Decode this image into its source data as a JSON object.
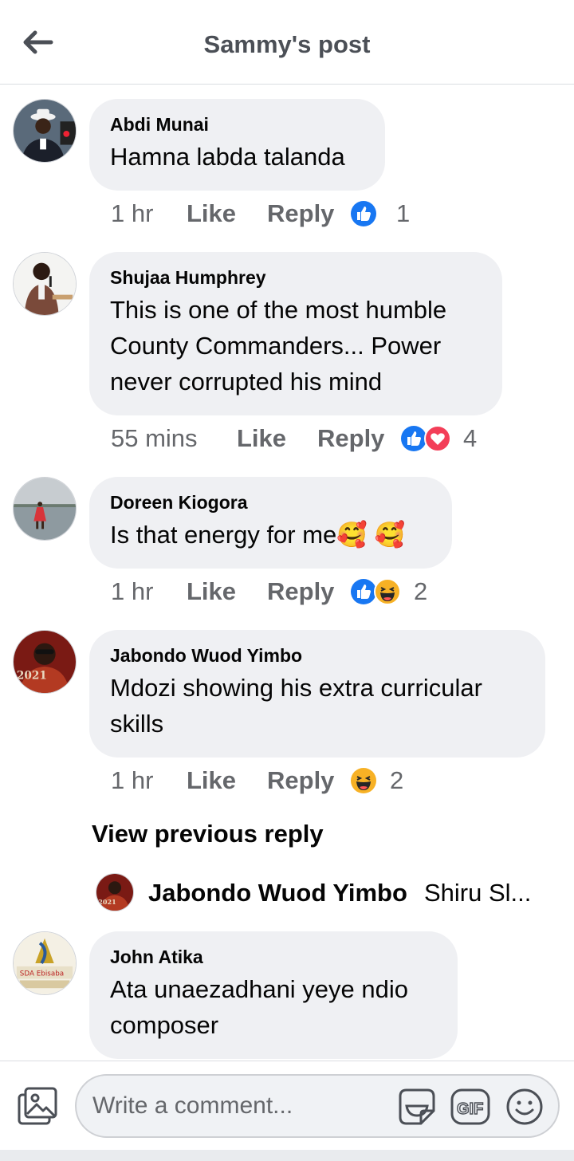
{
  "header": {
    "title": "Sammy's post"
  },
  "comments": [
    {
      "author": "Abdi Munai",
      "text": "Hamna labda talanda",
      "time": "1 hr",
      "like": "Like",
      "reply": "Reply",
      "reactions": [
        "like"
      ],
      "count": "1"
    },
    {
      "author": "Shujaa Humphrey",
      "text": "This is one of the most humble County Commanders... Power never corrupted his mind",
      "time": "55 mins",
      "like": "Like",
      "reply": "Reply",
      "reactions": [
        "like",
        "love"
      ],
      "count": "4"
    },
    {
      "author": "Doreen Kiogora",
      "text": "Is that energy for me🥰 🥰",
      "time": "1 hr",
      "like": "Like",
      "reply": "Reply",
      "reactions": [
        "like",
        "haha"
      ],
      "count": "2"
    },
    {
      "author": "Jabondo Wuod Yimbo",
      "text": "Mdozi showing his extra curricular skills",
      "time": "1 hr",
      "like": "Like",
      "reply": "Reply",
      "reactions": [
        "haha"
      ],
      "count": "2"
    },
    {
      "author": "John Atika",
      "text": "Ata unaezadhani  yeye ndio composer"
    }
  ],
  "view_previous": "View previous reply",
  "reply_preview": {
    "author": "Jabondo Wuod Yimbo",
    "text": "Shiru Sl..."
  },
  "composer": {
    "placeholder": "Write a comment..."
  },
  "icons": {
    "back": "back-arrow-icon",
    "photo": "photo-icon",
    "sticker": "sticker-icon",
    "gif": "gif-icon",
    "emoji": "emoji-icon"
  },
  "colors": {
    "like_blue": "#1877f2",
    "love_red": "#f33e58",
    "haha_yellow": "#f7b125",
    "bubble": "#eff0f3"
  }
}
